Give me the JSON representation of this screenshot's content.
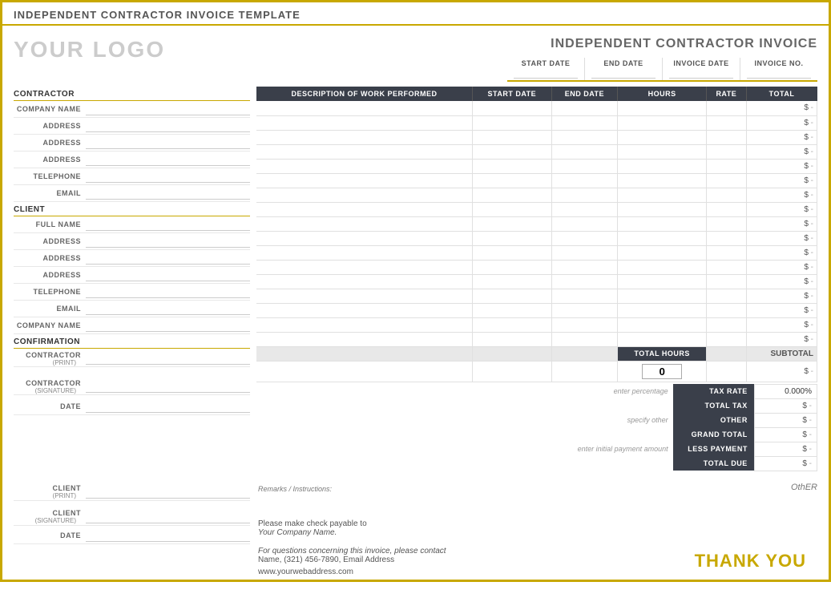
{
  "page": {
    "title": "Independent Contractor Invoice Template"
  },
  "header": {
    "logo": "YOUR LOGO",
    "invoice_title": "INDEPENDENT CONTRACTOR INVOICE",
    "date_fields": [
      {
        "label": "START DATE",
        "value": ""
      },
      {
        "label": "END DATE",
        "value": ""
      },
      {
        "label": "INVOICE DATE",
        "value": ""
      },
      {
        "label": "INVOICE NO.",
        "value": ""
      }
    ]
  },
  "contractor_section": {
    "header": "CONTRACTOR",
    "fields": [
      {
        "label": "COMPANY NAME",
        "value": ""
      },
      {
        "label": "ADDRESS",
        "value": ""
      },
      {
        "label": "ADDRESS",
        "value": ""
      },
      {
        "label": "ADDRESS",
        "value": ""
      },
      {
        "label": "TELEPHONE",
        "value": ""
      },
      {
        "label": "EMAIL",
        "value": ""
      }
    ]
  },
  "client_section": {
    "header": "CLIENT",
    "fields": [
      {
        "label": "FULL NAME",
        "value": ""
      },
      {
        "label": "ADDRESS",
        "value": ""
      },
      {
        "label": "ADDRESS",
        "value": ""
      },
      {
        "label": "ADDRESS",
        "value": ""
      },
      {
        "label": "TELEPHONE",
        "value": ""
      },
      {
        "label": "EMAIL",
        "value": ""
      },
      {
        "label": "COMPANY NAME",
        "value": ""
      }
    ]
  },
  "confirmation_section": {
    "header": "CONFIRMATION",
    "contractor_rows": [
      {
        "label": "CONTRACTOR",
        "sublabel": "(PRINT)",
        "has_sub": true
      },
      {
        "label": "CONTRACTOR",
        "sublabel": "(SIGNATURE)",
        "has_sub": true
      },
      {
        "label": "DATE",
        "sublabel": "",
        "has_sub": false
      }
    ],
    "client_rows": [
      {
        "label": "CLIENT",
        "sublabel": "(PRINT)",
        "has_sub": true
      },
      {
        "label": "CLIENT",
        "sublabel": "(SIGNATURE)",
        "has_sub": true
      },
      {
        "label": "DATE",
        "sublabel": "",
        "has_sub": false
      }
    ]
  },
  "work_table": {
    "headers": [
      "DESCRIPTION OF WORK PERFORMED",
      "START DATE",
      "END DATE",
      "HOURS",
      "RATE",
      "TOTAL"
    ],
    "rows": 17,
    "total_hours_label": "TOTAL HOURS",
    "total_hours_value": "0"
  },
  "summary": {
    "subtotal_label": "SUBTOTAL",
    "subtotal_value": "$",
    "subtotal_dash": "-",
    "tax_rate_label": "TAX RATE",
    "tax_rate_value": "0.000%",
    "tax_rate_hint": "enter percentage",
    "total_tax_label": "TOTAL TAX",
    "total_tax_value": "$",
    "total_tax_dash": "-",
    "other_label": "OTHER",
    "other_value": "$",
    "other_dash": "-",
    "other_hint": "specify other",
    "grand_total_label": "GRAND TOTAL",
    "grand_total_value": "$",
    "grand_total_dash": "-",
    "less_payment_label": "LESS PAYMENT",
    "less_payment_value": "$",
    "less_payment_dash": "-",
    "less_payment_hint": "enter initial payment amount",
    "total_due_label": "TOTAL DUE",
    "total_due_value": "$",
    "total_due_dash": "-"
  },
  "remarks": {
    "label": "Remarks / Instructions:"
  },
  "bottom": {
    "check_payable_line1": "Please make check payable to",
    "check_payable_line2": "Your Company Name.",
    "contact_line": "For questions concerning this invoice, please contact",
    "contact_details": "Name, (321) 456-7890, Email Address",
    "website": "www.yourwebaddress.com",
    "thank_you": "THANK YOU"
  }
}
